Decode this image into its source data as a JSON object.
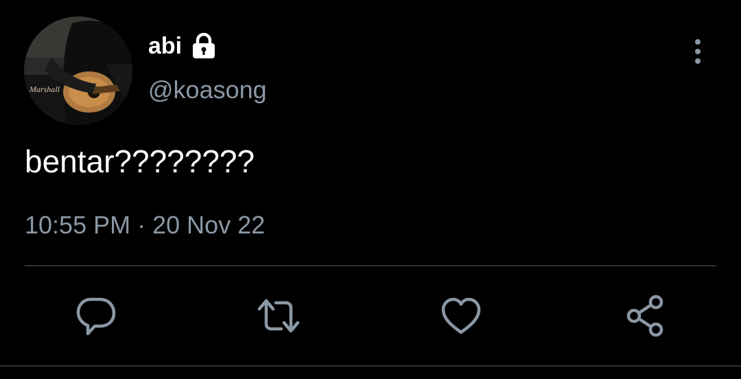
{
  "tweet": {
    "author": {
      "display_name": "abi",
      "handle": "@koasong",
      "protected": true,
      "avatar_description": "person playing acoustic guitar",
      "avatar_text": "Marshall"
    },
    "text": "bentar????????",
    "time": "10:55 PM",
    "separator": "·",
    "date": "20 Nov 22"
  },
  "icons": {
    "lock": "lock-icon",
    "more": "more-vertical-icon",
    "reply": "reply-icon",
    "retweet": "retweet-icon",
    "like": "heart-icon",
    "share": "share-icon"
  },
  "colors": {
    "background": "#000000",
    "primary_text": "#ffffff",
    "secondary_text": "#8b98a5",
    "divider": "#2f3336",
    "icon": "#8b98a5"
  }
}
